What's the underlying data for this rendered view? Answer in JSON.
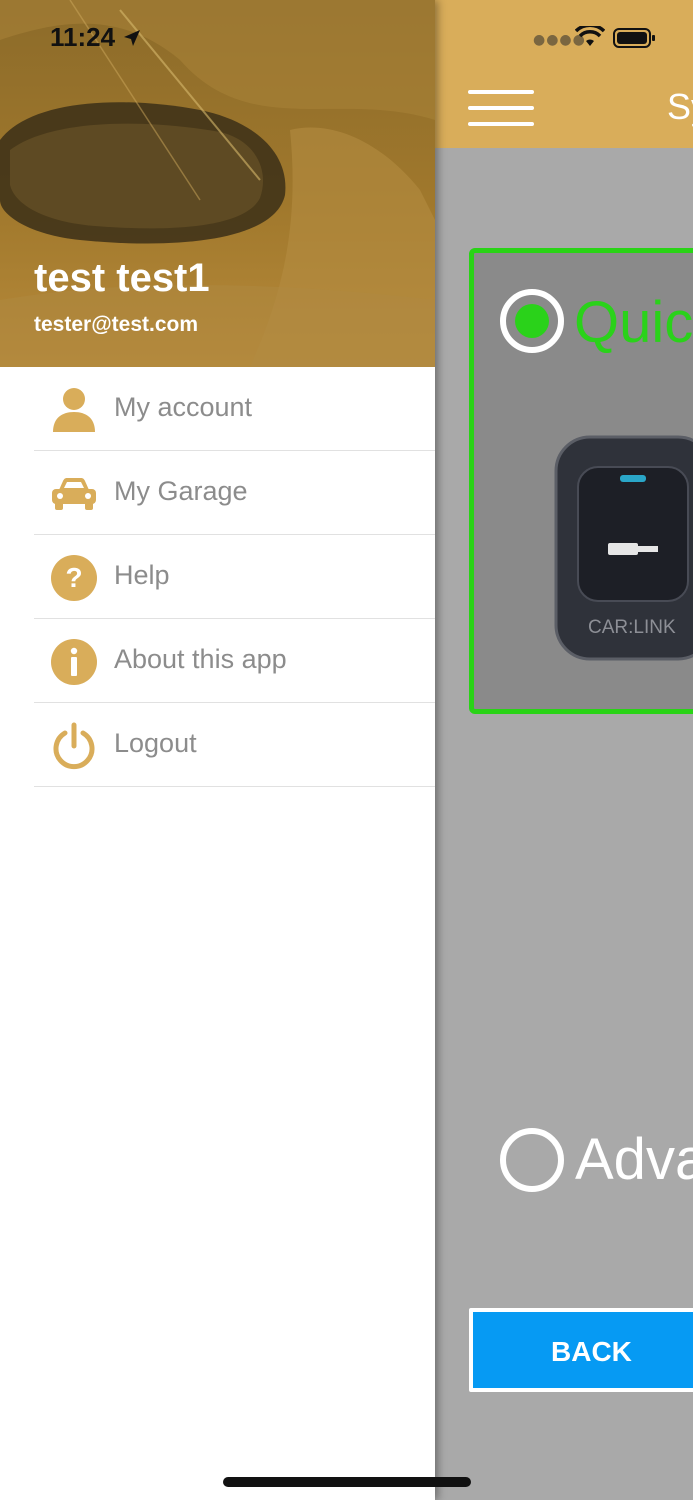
{
  "status_bar": {
    "time": "11:24"
  },
  "drawer": {
    "user_name": "test test1",
    "user_email": "tester@test.com",
    "menu": [
      {
        "label": "My account",
        "icon": "person-icon"
      },
      {
        "label": "My Garage",
        "icon": "car-icon"
      },
      {
        "label": "Help",
        "icon": "question-icon"
      },
      {
        "label": "About this app",
        "icon": "info-icon"
      },
      {
        "label": "Logout",
        "icon": "power-icon"
      }
    ]
  },
  "main": {
    "header_title": "Sy",
    "options": [
      {
        "label": "Quic",
        "selected": true
      },
      {
        "label": "Adva",
        "selected": false
      }
    ],
    "remote_brand": "CAR:LINK",
    "back_label": "BACK"
  },
  "colors": {
    "accent": "#d9ad5a",
    "selected_green": "#2ad21a",
    "button_blue": "#069af3",
    "menu_text": "#8c8c8c"
  }
}
